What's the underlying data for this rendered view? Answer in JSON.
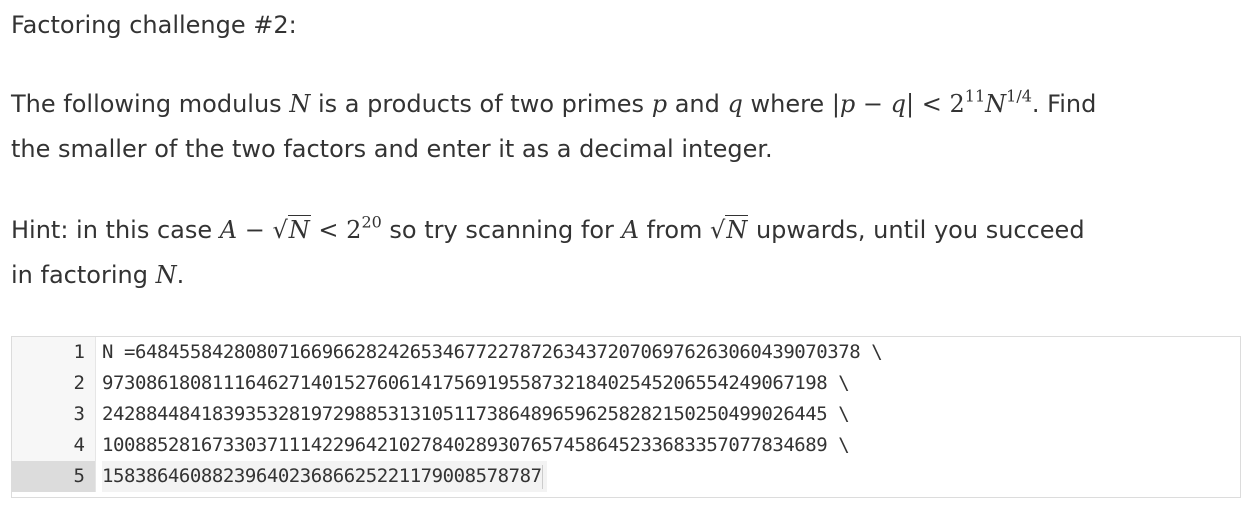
{
  "challenge": {
    "title": "Factoring challenge #2:",
    "para1": {
      "line1_prefix": "The following modulus ",
      "var_N": "N",
      "line1_mid1": " is a products of two primes ",
      "var_p": "p",
      "line1_and": " and ",
      "var_q": "q",
      "line1_where": " where |",
      "expr_pq_p": "p",
      "expr_pq_minus": " − ",
      "expr_pq_q": "q",
      "expr_lt": "| < 2",
      "exp_11": "11",
      "expr_N": "N",
      "exp_quarter": "1/4",
      "line1_suffix": ". Find",
      "line2": "the smaller of the two factors and enter it as a decimal integer."
    },
    "para2": {
      "hint_prefix": "Hint: in this case ",
      "var_A": "A",
      "minus": " − ",
      "sqrt_symbol": "√",
      "sqrt_N": "N",
      "lt_two": " < 2",
      "exp_20": "20",
      "mid": " so try scanning for ",
      "var_A2": "A",
      "from": " from ",
      "sqrt_symbol2": "√",
      "sqrt_N2": "N",
      "suffix": " upwards, until you succeed",
      "line2_prefix": "in factoring ",
      "var_N_end": "N",
      "line2_suffix": "."
    }
  },
  "code_editor": {
    "lines": [
      {
        "number": "1",
        "text": "N =648455842808071669662824265346772278726343720706976263060439070378 \\"
      },
      {
        "number": "2",
        "text": "973086180811164627140152760614175691955873218402545206554249067198 \\"
      },
      {
        "number": "3",
        "text": "242884484183935328197298853131051173864896596258282150250499026445 \\"
      },
      {
        "number": "4",
        "text": "100885281673303711142296421027840289307657458645233683357077834689 \\"
      },
      {
        "number": "5",
        "text": "1583864608823964023686625221179008578787"
      }
    ],
    "active_line_index": 4
  }
}
